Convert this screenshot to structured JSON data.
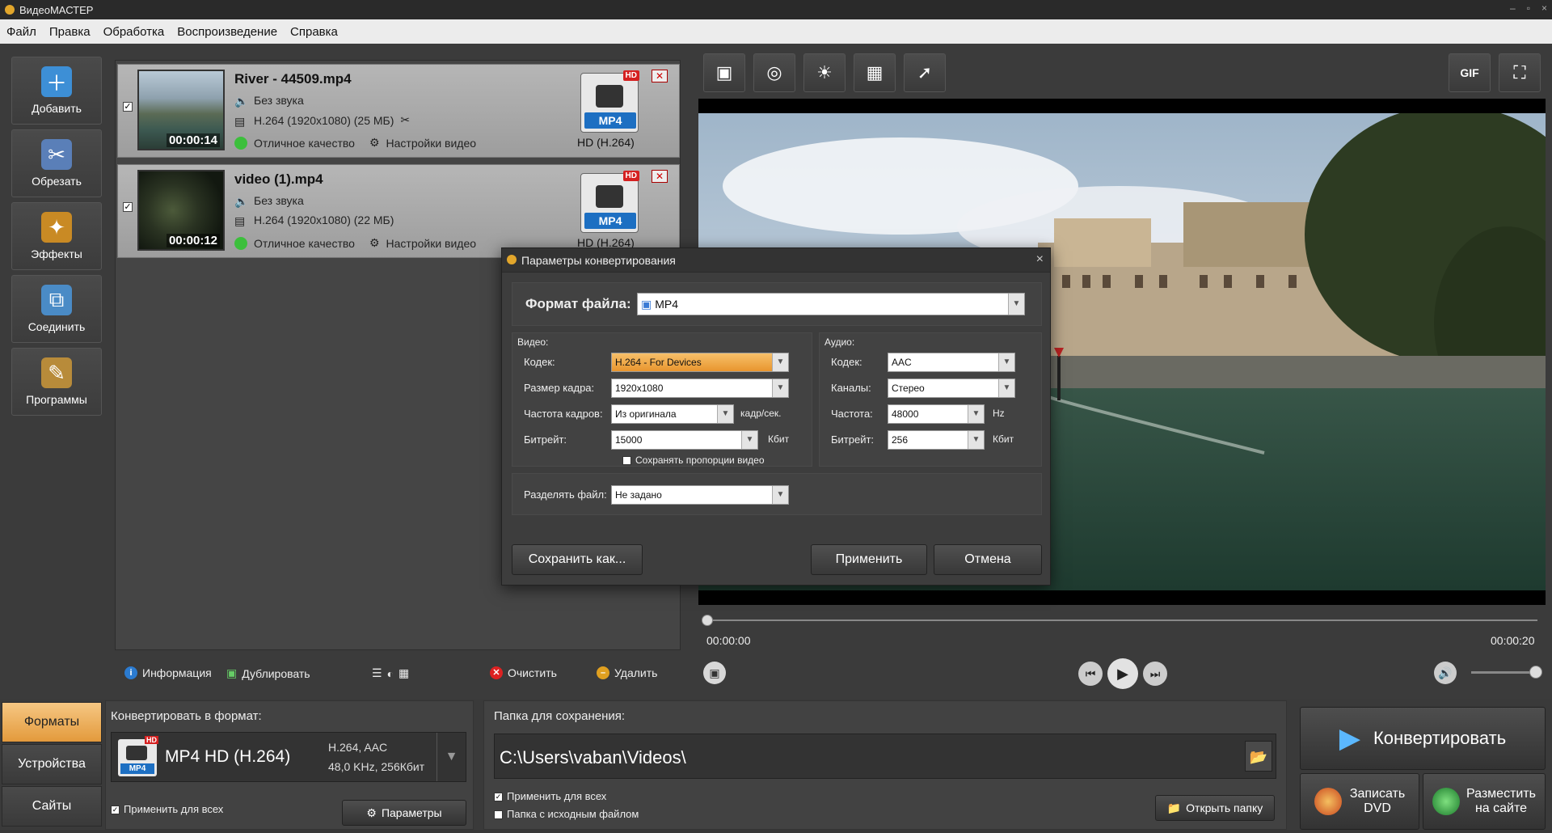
{
  "window": {
    "title": "ВидеоМАСТЕР"
  },
  "menu": [
    "Файл",
    "Правка",
    "Обработка",
    "Воспроизведение",
    "Справка"
  ],
  "sidebar": [
    {
      "label": "Добавить",
      "icon": "add-film-icon",
      "color": "#3d8fd6"
    },
    {
      "label": "Обрезать",
      "icon": "scissors-icon",
      "color": "#5a7fb8"
    },
    {
      "label": "Эффекты",
      "icon": "effects-icon",
      "color": "#c98a24"
    },
    {
      "label": "Соединить",
      "icon": "join-icon",
      "color": "#4a8bc6"
    },
    {
      "label": "Программы",
      "icon": "programs-icon",
      "color": "#b88b3a"
    }
  ],
  "files": [
    {
      "name": "River - 44509.mp4",
      "duration": "00:00:14",
      "audio": "Без звука",
      "video": "H.264 (1920x1080) (25 МБ)",
      "quality": "Отличное качество",
      "settings": "Настройки видео",
      "format_badge": "MP4",
      "hd_badge": "HD",
      "format_label": "HD (H.264)",
      "checked": "✓"
    },
    {
      "name": "video (1).mp4",
      "duration": "00:00:12",
      "audio": "Без звука",
      "video": "H.264 (1920x1080) (22 МБ)",
      "quality": "Отличное качество",
      "settings": "Настройки видео",
      "format_badge": "MP4",
      "hd_badge": "HD",
      "format_label": "HD (H.264)",
      "checked": "✓"
    }
  ],
  "list_tools": {
    "info": "Информация",
    "duplicate": "Дублировать",
    "clear": "Очистить",
    "delete": "Удалить"
  },
  "player": {
    "time_current": "00:00:00",
    "time_total": "00:00:20",
    "progress": 0,
    "volume": 1.0
  },
  "dialog": {
    "title": "Параметры конвертирования",
    "format_label": "Формат файла:",
    "format_value": "MP4",
    "video_section": "Видео:",
    "audio_section": "Аудио:",
    "video": {
      "codec_label": "Кодек:",
      "codec_value": "H.264 - For Devices",
      "frame_label": "Размер кадра:",
      "frame_value": "1920x1080",
      "fps_label": "Частота кадров:",
      "fps_value": "Из оригинала",
      "fps_unit": "кадр/сек.",
      "bitrate_label": "Битрейт:",
      "bitrate_value": "15000",
      "bitrate_unit": "Кбит",
      "keep_aspect": "Сохранять пропорции видео"
    },
    "audio": {
      "codec_label": "Кодек:",
      "codec_value": "AAC",
      "channels_label": "Каналы:",
      "channels_value": "Стерео",
      "freq_label": "Частота:",
      "freq_value": "48000",
      "freq_unit": "Hz",
      "bitrate_label": "Битрейт:",
      "bitrate_value": "256",
      "bitrate_unit": "Кбит"
    },
    "split_label": "Разделять файл:",
    "split_value": "Не задано",
    "save_as": "Сохранить как...",
    "apply": "Применить",
    "cancel": "Отмена",
    "close": "×"
  },
  "bottom": {
    "tabs": [
      "Форматы",
      "Устройства",
      "Сайты"
    ],
    "convert_to_label": "Конвертировать в формат:",
    "format_name": "MP4 HD (H.264)",
    "format_codecs": "H.264, AAC",
    "format_audio": "48,0 KHz, 256Кбит",
    "format_badge": "MP4",
    "format_hd": "HD",
    "apply_all": "Применить для всех",
    "params": "Параметры",
    "save_folder_label": "Папка для сохранения:",
    "save_path": "C:\\Users\\vaban\\Videos\\",
    "apply_all_2": "Применить для всех",
    "source_folder": "Папка с исходным файлом",
    "open_folder": "Открыть папку",
    "convert": "Конвертировать",
    "burn_dvd_1": "Записать",
    "burn_dvd_2": "DVD",
    "publish_1": "Разместить",
    "publish_2": "на сайте"
  }
}
